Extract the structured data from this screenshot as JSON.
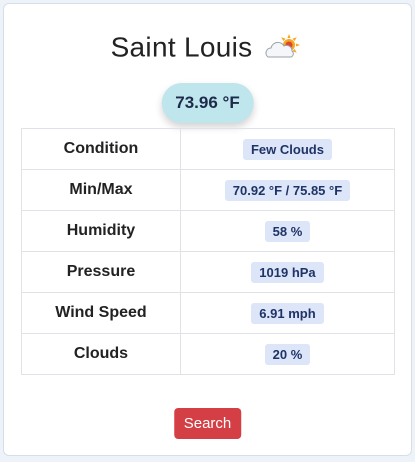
{
  "weather": {
    "city": "Saint Louis",
    "icon": "few-clouds-icon",
    "temperature": "73.96 °F"
  },
  "details": [
    {
      "label": "Condition",
      "value": "Few Clouds"
    },
    {
      "label": "Min/Max",
      "value": "70.92 °F / 75.85 °F"
    },
    {
      "label": "Humidity",
      "value": "58 %"
    },
    {
      "label": "Pressure",
      "value": "1019 hPa"
    },
    {
      "label": "Wind Speed",
      "value": "6.91 mph"
    },
    {
      "label": "Clouds",
      "value": "20 %"
    }
  ],
  "actions": {
    "search_label": "Search"
  },
  "colors": {
    "temperature_pill": "#bfe6ec",
    "badge_background": "#dde6f8",
    "search_button": "#d43f45"
  }
}
